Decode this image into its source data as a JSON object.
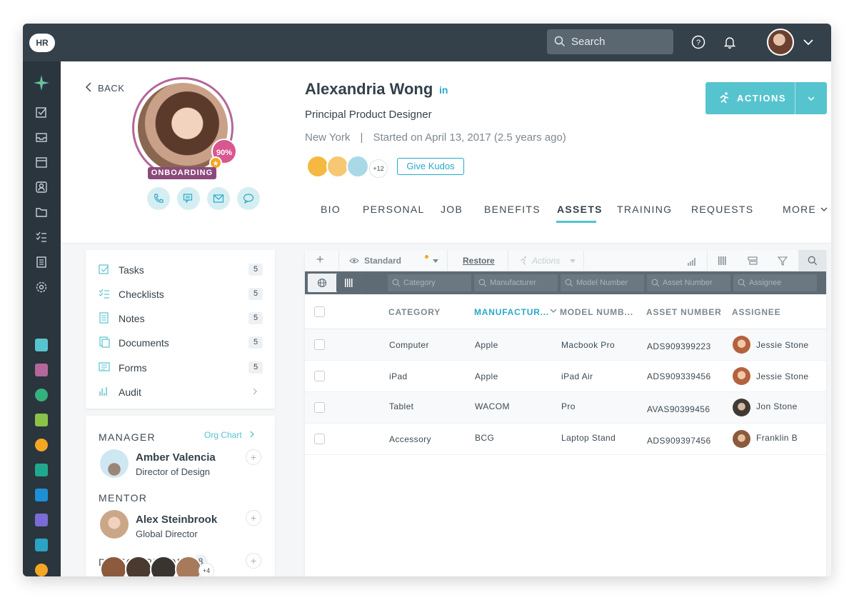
{
  "topbar": {
    "logo": "HR",
    "search_placeholder": "Search"
  },
  "profile": {
    "back_label": "BACK",
    "completion": "90%",
    "status_badge": "ONBOARDING",
    "name": "Alexandria Wong",
    "linkedin": "in",
    "job_title": "Principal Product Designer",
    "location": "New York",
    "separator": "|",
    "started": "Started on April 13, 2017 (2.5 years ago)",
    "badges_more": "+12",
    "kudos_label": "Give Kudos",
    "actions_label": "ACTIONS"
  },
  "tabs": [
    "BIO",
    "PERSONAL",
    "JOB",
    "BENEFITS",
    "ASSETS",
    "TRAINING",
    "REQUESTS",
    "MORE"
  ],
  "active_tab": "ASSETS",
  "left_menu": [
    {
      "label": "Tasks",
      "count": "5",
      "icon": "check-square-icon"
    },
    {
      "label": "Checklists",
      "count": "5",
      "icon": "checklist-icon"
    },
    {
      "label": "Notes",
      "count": "5",
      "icon": "note-icon"
    },
    {
      "label": "Documents",
      "count": "5",
      "icon": "documents-icon"
    },
    {
      "label": "Forms",
      "count": "5",
      "icon": "forms-icon"
    },
    {
      "label": "Audit",
      "count": "",
      "icon": "audit-icon"
    }
  ],
  "people": {
    "manager_label": "MANAGER",
    "org_chart_label": "Org Chart",
    "manager": {
      "name": "Amber Valencia",
      "role": "Director of Design"
    },
    "mentor_label": "MENTOR",
    "mentor": {
      "name": "Alex Steinbrook",
      "role": "Global Director"
    },
    "direct_reports_label": "DIRECT REPORTS",
    "direct_reports_count": "8",
    "direct_reports_more": "+4"
  },
  "grid": {
    "toolbar": {
      "add": "+",
      "view": "Standard",
      "restore": "Restore",
      "actions": "Actions"
    },
    "filters": [
      "Category",
      "Manufacturer",
      "Model Number",
      "Asset Number",
      "Assignee"
    ],
    "columns": [
      "CATEGORY",
      "MANUFACTUR...",
      "MODEL NUMB...",
      "ASSET NUMBER",
      "ASSIGNEE"
    ],
    "sorted_column": "MANUFACTUR...",
    "rows": [
      {
        "category": "Computer",
        "manufacturer": "Apple",
        "model": "Macbook Pro",
        "asset": "ADS909399223",
        "assignee": "Jessie Stone"
      },
      {
        "category": "iPad",
        "manufacturer": "Apple",
        "model": "iPad Air",
        "asset": "ADS909339456",
        "assignee": "Jessie Stone"
      },
      {
        "category": "Tablet",
        "manufacturer": "WACOM",
        "model": "Pro",
        "asset": "AVAS90399456",
        "assignee": "Jon Stone"
      },
      {
        "category": "Accessory",
        "manufacturer": "BCG",
        "model": "Laptop Stand",
        "asset": "ADS909397456",
        "assignee": "Franklin B"
      }
    ]
  },
  "colors": {
    "accent": "#56c4cf",
    "topbar": "#34414b",
    "sidenav": "#2b353d",
    "onboarding": "#8c4a7b",
    "completion": "#d9578f"
  }
}
